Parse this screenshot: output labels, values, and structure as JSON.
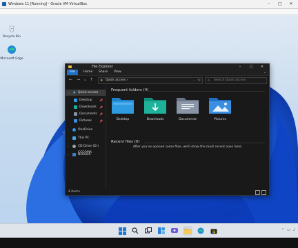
{
  "vbox": {
    "title": "Windows 11 [Running] - Oracle VM VirtualBox",
    "controls": [
      "–",
      "□",
      "✕"
    ]
  },
  "desktop_icons": [
    {
      "label": "Recycle Bin",
      "icon": "recycle-bin-icon"
    },
    {
      "label": "Microsoft Edge",
      "icon": "edge-icon"
    }
  ],
  "explorer": {
    "title": "File Explorer",
    "window_controls": [
      "–",
      "□",
      "✕"
    ],
    "ribbon_tabs": [
      "File",
      "Home",
      "Share",
      "View"
    ],
    "nav_buttons": [
      "←",
      "→",
      "⌄",
      "↑"
    ],
    "address": "Quick access",
    "address_separator": "›",
    "search_placeholder": "Search Quick access",
    "sidebar": [
      {
        "label": "Quick access",
        "icon": "star-icon",
        "selected": true
      },
      {
        "label": "Desktop",
        "icon": "desktop-icon",
        "pinned": true
      },
      {
        "label": "Downloads",
        "icon": "downloads-icon",
        "pinned": true
      },
      {
        "label": "Documents",
        "icon": "documents-icon",
        "pinned": true
      },
      {
        "label": "Pictures",
        "icon": "pictures-icon",
        "pinned": true
      },
      {
        "label": "OneDrive",
        "icon": "onedrive-icon"
      },
      {
        "label": "This PC",
        "icon": "this-pc-icon"
      },
      {
        "label": "CD Drive (D:) CCCOMA",
        "icon": "cd-drive-icon"
      },
      {
        "label": "Network",
        "icon": "network-icon"
      }
    ],
    "frequent_heading": "Frequent folders (4)",
    "frequent_folders": [
      {
        "label": "Desktop",
        "icon": "desktop-folder-icon"
      },
      {
        "label": "Downloads",
        "icon": "downloads-folder-icon"
      },
      {
        "label": "Documents",
        "icon": "documents-folder-icon"
      },
      {
        "label": "Pictures",
        "icon": "pictures-folder-icon"
      }
    ],
    "recent_heading": "Recent files (0)",
    "recent_empty_message": "After you've opened some files, we'll show the most recent ones here.",
    "status_count": "4 items"
  },
  "colors": {
    "accent": "#1f6fc4",
    "folder_blue": "#2f9be0",
    "folder_teal": "#1fb29b",
    "folder_gray": "#8a96a8",
    "wallpaper_bloom": "#1a5bd6"
  }
}
